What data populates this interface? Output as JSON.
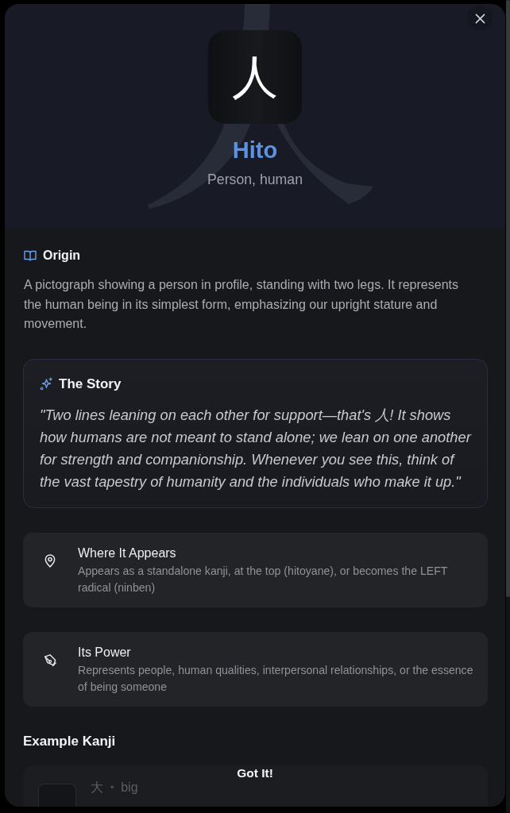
{
  "header": {
    "kanji": "人",
    "reading": "Hito",
    "meaning": "Person, human"
  },
  "origin": {
    "title": "Origin",
    "text": "A pictograph showing a person in profile, standing with two legs. It represents the human being in its simplest form, emphasizing our upright stature and movement."
  },
  "story": {
    "title": "The Story",
    "text": "\"Two lines leaning on each other for support—that's 人! It shows how humans are not meant to stand alone; we lean on one another for strength and companionship. Whenever you see this, think of the vast tapestry of humanity and the individuals who make it up.\""
  },
  "facts": [
    {
      "kind": "location",
      "title": "Where It Appears",
      "text": "Appears as a standalone kanji, at the top (hitoyane), or becomes the LEFT radical (ninben)"
    },
    {
      "kind": "power",
      "title": "Its Power",
      "text": "Represents people, human qualities, interpersonal relationships, or the essence of being someone"
    }
  ],
  "examples": {
    "title": "Example Kanji",
    "items": [
      {
        "kanji": "大",
        "separator": "•",
        "meaning": "big"
      }
    ]
  },
  "footer": {
    "button": "Got It!"
  }
}
